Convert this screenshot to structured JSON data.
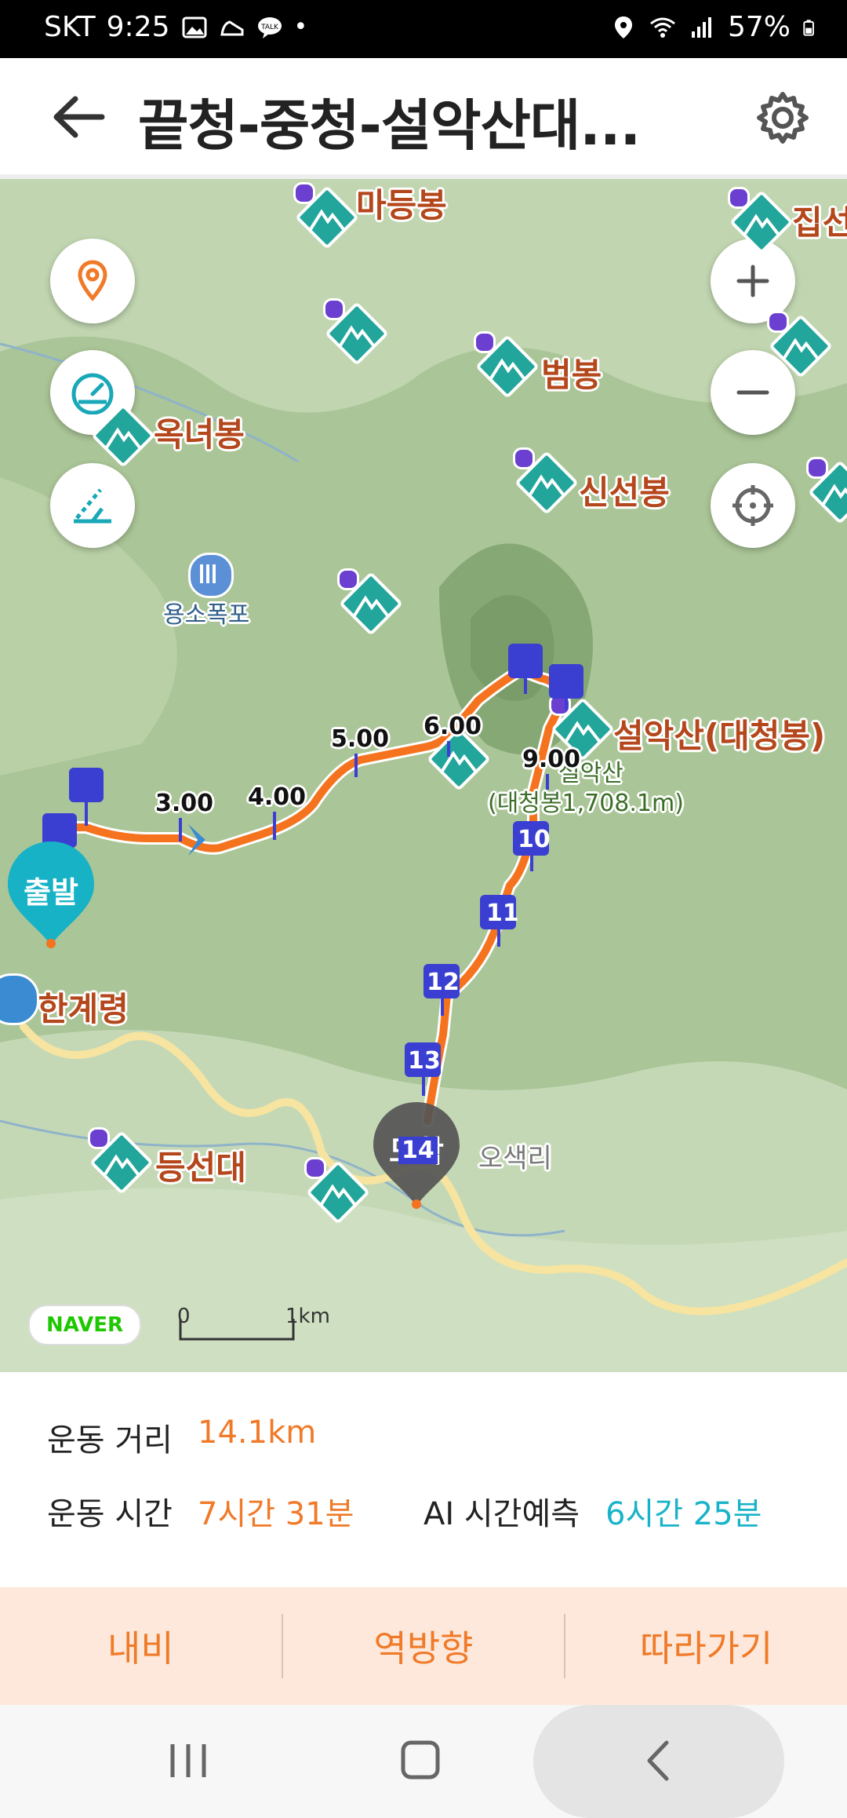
{
  "status_bar": {
    "carrier": "SKT",
    "time": "9:25",
    "battery": "57%",
    "icons": [
      "image-icon",
      "shoe-icon",
      "talk-icon",
      "dot-icon",
      "location-icon",
      "wifi-icon",
      "signal-icon",
      "battery-icon"
    ],
    "talk_label": "TALK"
  },
  "header": {
    "title": "끝청-중청-설악산대...",
    "back_icon": "arrow-left-icon",
    "settings_icon": "gear-icon"
  },
  "map": {
    "places": [
      {
        "name": "마등봉"
      },
      {
        "name": "집선"
      },
      {
        "name": "범봉"
      },
      {
        "name": "옥녀봉"
      },
      {
        "name": "신선봉"
      },
      {
        "name": "용소폭포"
      },
      {
        "name": "설악산(대청봉)"
      },
      {
        "name": "한계령"
      },
      {
        "name": "등선대"
      },
      {
        "name": "오색리"
      },
      {
        "name": "설악산"
      },
      {
        "name": "(대청봉1,708.1m)"
      }
    ],
    "km_markers": [
      "3.00",
      "4.00",
      "5.00",
      "6.00",
      "9.00",
      "10",
      "11",
      "12",
      "13",
      "14"
    ],
    "start_label": "출발",
    "end_label": "도착",
    "naver_logo": "NAVER",
    "scale": {
      "zero": "0",
      "unit": "1km"
    },
    "controls": {
      "left": [
        "location-pin-icon",
        "speedometer-icon",
        "slope-icon"
      ],
      "right": [
        "zoom-in-icon",
        "zoom-out-icon",
        "crosshair-icon"
      ]
    },
    "colors": {
      "route": "#f5731e",
      "marker": "#3a3fd1",
      "start": "#17b2c6",
      "end": "#444444",
      "mountain": "#22a59a"
    }
  },
  "stats": {
    "distance_label": "운동 거리",
    "distance_value": "14.1km",
    "time_label": "운동 시간",
    "time_value": "7시간 31분",
    "ai_label": "AI 시간예측",
    "ai_value": "6시간 25분"
  },
  "actions": {
    "nav": "내비",
    "reverse": "역방향",
    "follow": "따라가기"
  },
  "system_nav": [
    "recents-icon",
    "home-icon",
    "back-icon"
  ]
}
